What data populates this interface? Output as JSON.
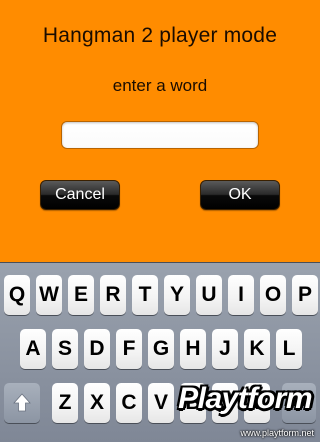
{
  "screen": {
    "title": "Hangman 2 player mode",
    "subtitle": "enter a word",
    "input_value": "",
    "input_placeholder": ""
  },
  "buttons": {
    "cancel": "Cancel",
    "ok": "OK"
  },
  "keyboard": {
    "row1": [
      "Q",
      "W",
      "E",
      "R",
      "T",
      "Y",
      "U",
      "I",
      "O",
      "P"
    ],
    "row2": [
      "A",
      "S",
      "D",
      "F",
      "G",
      "H",
      "J",
      "K",
      "L"
    ],
    "row3": [
      "Z",
      "X",
      "C",
      "V",
      "B",
      "N",
      "M"
    ]
  },
  "watermark": {
    "logo": "Playtform",
    "url": "www.playtform.net"
  },
  "colors": {
    "background": "#ff8c00",
    "keyboard_bg": "#8b93a1",
    "button_dark": "#000000"
  }
}
